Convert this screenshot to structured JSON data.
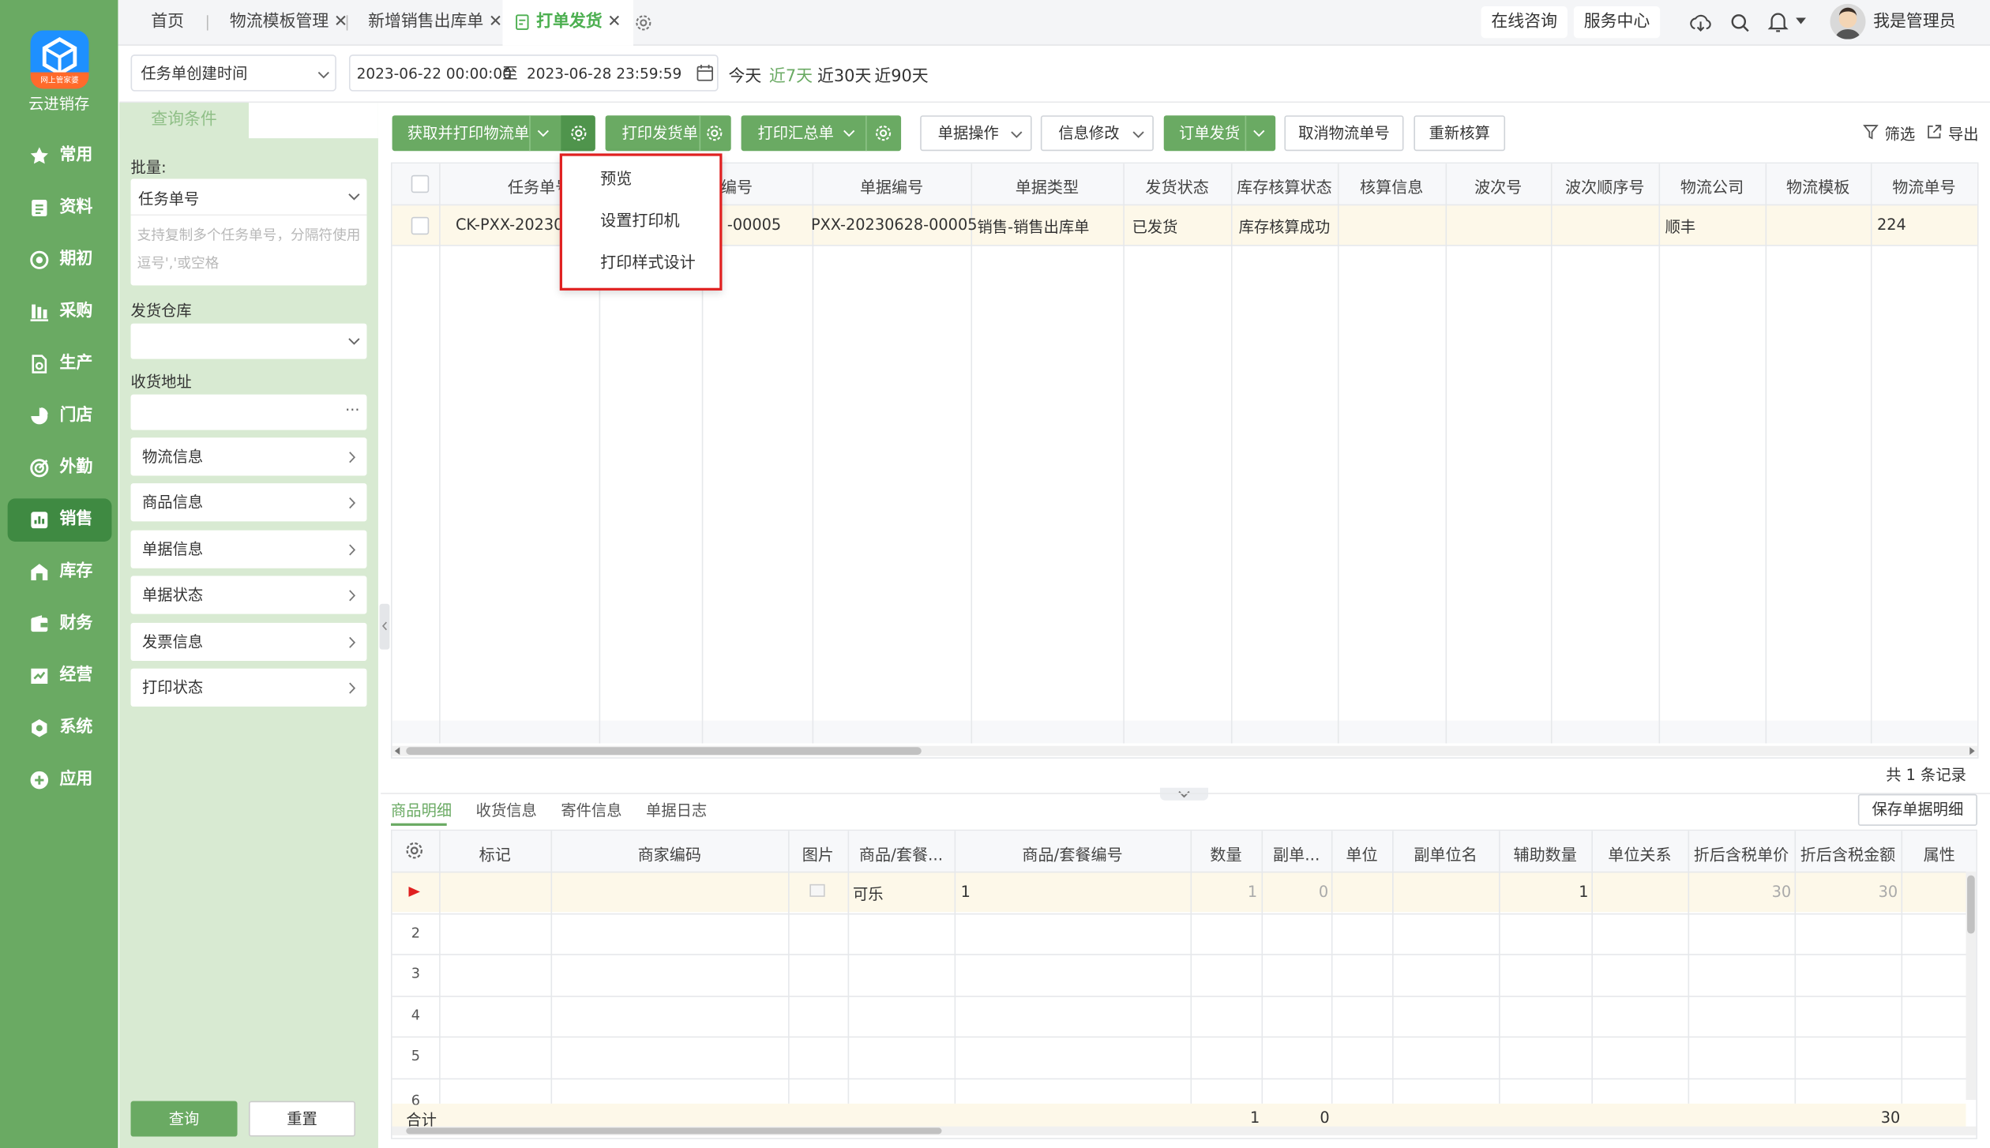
{
  "sidebar": {
    "logo_text": "网上管家婆",
    "brand": "云进销存",
    "items": [
      {
        "label": "常用",
        "icon": "star-icon"
      },
      {
        "label": "资料",
        "icon": "document-icon"
      },
      {
        "label": "期初",
        "icon": "target-icon"
      },
      {
        "label": "采购",
        "icon": "purchase-icon"
      },
      {
        "label": "生产",
        "icon": "production-icon"
      },
      {
        "label": "门店",
        "icon": "store-pie-icon"
      },
      {
        "label": "外勤",
        "icon": "field-target-icon"
      },
      {
        "label": "销售",
        "icon": "sales-chart-icon"
      },
      {
        "label": "库存",
        "icon": "warehouse-icon"
      },
      {
        "label": "财务",
        "icon": "wallet-icon"
      },
      {
        "label": "经营",
        "icon": "business-icon"
      },
      {
        "label": "系统",
        "icon": "system-icon"
      },
      {
        "label": "应用",
        "icon": "plus-app-icon"
      }
    ],
    "active_index": 7
  },
  "tabs": [
    {
      "label": "首页"
    },
    {
      "label": "物流模板管理"
    },
    {
      "label": "新增销售出库单"
    },
    {
      "label": "打单发货"
    }
  ],
  "header": {
    "online": "在线咨询",
    "service": "服务中心",
    "user": "我是管理员"
  },
  "filter": {
    "time_field": "任务单创建时间",
    "date_start": "2023-06-22 00:00:00",
    "date_sep": "至",
    "date_end": "2023-06-28 23:59:59",
    "quick": [
      "今天",
      "近7天",
      "近30天",
      "近90天"
    ],
    "quick_active": 1
  },
  "query": {
    "tab": "查询条件",
    "batch_label": "批量:",
    "batch_field": "任务单号",
    "batch_hint": "支持复制多个任务单号，分隔符使用逗号','或空格",
    "warehouse_label": "发货仓库",
    "address_label": "收货地址",
    "groups": [
      "物流信息",
      "商品信息",
      "单据信息",
      "单据状态",
      "发票信息",
      "打印状态"
    ],
    "query_btn": "查询",
    "reset_btn": "重置"
  },
  "toolbar": {
    "get_print": "获取并打印物流单",
    "print_ship": "打印发货单",
    "print_summary": "打印汇总单",
    "doc_ops": "单据操作",
    "info_edit": "信息修改",
    "order_ship": "订单发货",
    "cancel_tracking": "取消物流单号",
    "recheck": "重新核算",
    "filter": "筛选",
    "export": "导出"
  },
  "menu": {
    "items": [
      "预览",
      "设置打印机",
      "打印样式设计"
    ]
  },
  "main_table": {
    "columns": [
      "任务单号",
      "编号",
      "单据编号",
      "单据类型",
      "发货状态",
      "库存核算状态",
      "核算信息",
      "波次号",
      "波次顺序号",
      "物流公司",
      "物流模板",
      "物流单号"
    ],
    "rows": [
      {
        "task": "CK-PXX-202306",
        "code": "-00005",
        "doc": "PXX-20230628-00005",
        "type": "销售-销售出库单",
        "ship": "已发货",
        "stock": "库存核算成功",
        "acc": "",
        "wave": "",
        "wave_seq": "",
        "carrier": "顺丰",
        "template": "",
        "tracking": "224"
      }
    ],
    "total": "共 1 条记录"
  },
  "bottom": {
    "tabs": [
      "商品明细",
      "收货信息",
      "寄件信息",
      "单据日志"
    ],
    "active_tab": 0,
    "save_btn": "保存单据明细",
    "columns": [
      "标记",
      "商家编码",
      "图片",
      "商品/套餐...",
      "商品/套餐编号",
      "数量",
      "副单...",
      "单位",
      "副单位名",
      "辅助数量",
      "单位关系",
      "折后含税单价",
      "折后含税金额",
      "属性"
    ],
    "rows": [
      {
        "no": "",
        "mark": "",
        "code": "",
        "name": "可乐",
        "num": "1",
        "qty": "1",
        "sub": "0",
        "unit": "",
        "subname": "",
        "aux": "1",
        "rel": "",
        "price": "30",
        "amount": "30"
      },
      {
        "no": "2"
      },
      {
        "no": "3"
      },
      {
        "no": "4"
      },
      {
        "no": "5"
      },
      {
        "no": "6"
      }
    ],
    "sum": {
      "label": "合计",
      "qty": "1",
      "sub": "0",
      "amount": "30"
    }
  }
}
